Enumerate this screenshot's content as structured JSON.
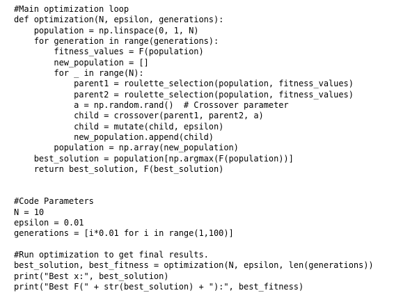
{
  "code": {
    "lines": [
      "#Main optimization loop",
      "def optimization(N, epsilon, generations):",
      "    population = np.linspace(0, 1, N)",
      "    for generation in range(generations):",
      "        fitness_values = F(population)",
      "        new_population = []",
      "        for _ in range(N):",
      "            parent1 = roulette_selection(population, fitness_values)",
      "            parent2 = roulette_selection(population, fitness_values)",
      "            a = np.random.rand()  # Crossover parameter",
      "            child = crossover(parent1, parent2, a)",
      "            child = mutate(child, epsilon)",
      "            new_population.append(child)",
      "        population = np.array(new_population)",
      "    best_solution = population[np.argmax(F(population))]",
      "    return best_solution, F(best_solution)",
      "",
      "",
      "#Code Parameters",
      "N = 10",
      "epsilon = 0.01",
      "generations = [i*0.01 for i in range(1,100)]",
      "",
      "#Run optimization to get final results.",
      "best_solution, best_fitness = optimization(N, epsilon, len(generations))",
      "print(\"Best x:\", best_solution)",
      "print(\"Best F(\" + str(best_solution) + \"):\", best_fitness)"
    ]
  }
}
